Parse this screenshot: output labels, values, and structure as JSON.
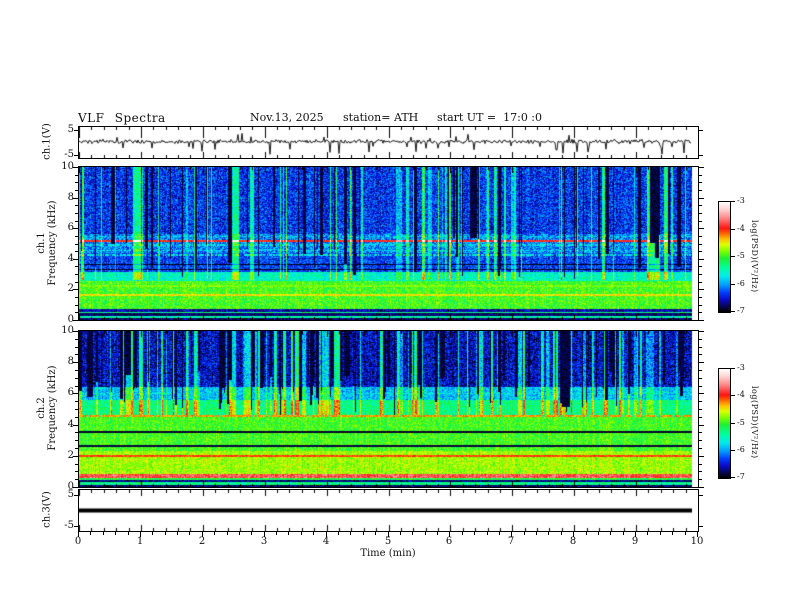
{
  "header": {
    "title": "VLF Spectra",
    "date": "Nov.13, 2025",
    "station": "station= ATH",
    "start_ut": "start UT =  17:0 :0"
  },
  "time_axis": {
    "label": "Time  (min)",
    "major_ticks": [
      0,
      1,
      2,
      3,
      4,
      5,
      6,
      7,
      8,
      9,
      10
    ],
    "minor_step_min": 0.2,
    "range_min": [
      0,
      10
    ]
  },
  "colorbar": {
    "label": "log(PSD)(V²/Hz)",
    "ticks": [
      -3,
      -4,
      -5,
      -6,
      -7
    ],
    "range": [
      -7,
      -3
    ],
    "stops": [
      [
        -7,
        0,
        0,
        0
      ],
      [
        -6.85,
        5,
        5,
        60
      ],
      [
        -6.55,
        10,
        10,
        200
      ],
      [
        -6.3,
        0,
        60,
        255
      ],
      [
        -6.0,
        0,
        160,
        255
      ],
      [
        -5.7,
        0,
        235,
        235
      ],
      [
        -5.4,
        0,
        255,
        160
      ],
      [
        -5.05,
        30,
        240,
        50
      ],
      [
        -4.8,
        120,
        255,
        0
      ],
      [
        -4.55,
        220,
        255,
        0
      ],
      [
        -4.35,
        255,
        190,
        0
      ],
      [
        -4.1,
        255,
        80,
        0
      ],
      [
        -3.95,
        255,
        20,
        20
      ],
      [
        -3.6,
        255,
        130,
        130
      ],
      [
        -3.3,
        255,
        205,
        205
      ],
      [
        -3,
        255,
        255,
        255
      ]
    ]
  },
  "chart_data": [
    {
      "type": "line",
      "id": "wave1",
      "ylabel": "ch.1(V)",
      "yticks": [
        5,
        -5
      ],
      "ylim": [
        -6.5,
        6.5
      ],
      "xlim_min": [
        0,
        10
      ],
      "signal": {
        "baseline_V": 0.4,
        "noise_sigma_V": 0.5,
        "spike_down": {
          "probability_per_sample": 0.05,
          "amplitude_V": [
            1.5,
            5.0
          ]
        },
        "spike_up": {
          "probability_per_sample": 0.015,
          "amplitude_V": [
            1.0,
            2.8
          ]
        }
      },
      "description": "broadband noisy trace near 0 V with frequent negative transient spikes"
    },
    {
      "type": "heatmap",
      "id": "spec1",
      "channel": "ch.1",
      "ylabel": "Frequency  (kHz)",
      "yticks": [
        0,
        2,
        4,
        6,
        8,
        10
      ],
      "ylim_kHz": [
        0,
        10
      ],
      "zlabel": "log(PSD)(V²/Hz)",
      "zlim": [
        -7,
        -3
      ],
      "bands": [
        {
          "f0": 0.0,
          "f1": 0.1,
          "v": -6.8,
          "n": 0.25
        },
        {
          "f0": 0.1,
          "f1": 0.22,
          "v": -5.45,
          "n": 0.3
        },
        {
          "f0": 0.22,
          "f1": 0.4,
          "v": -6.75,
          "n": 0.2
        },
        {
          "f0": 0.4,
          "f1": 0.52,
          "v": -5.3,
          "n": 0.3
        },
        {
          "f0": 0.52,
          "f1": 0.66,
          "v": -6.6,
          "n": 0.3
        },
        {
          "f0": 0.66,
          "f1": 2.55,
          "v": -4.95,
          "n": 0.28
        },
        {
          "f0": 2.55,
          "f1": 3.15,
          "v": -5.55,
          "n": 0.3
        },
        {
          "f0": 3.15,
          "f1": 4.4,
          "v": -6.3,
          "n": 0.35
        },
        {
          "f0": 4.4,
          "f1": 5.6,
          "v": -6.05,
          "n": 0.45
        },
        {
          "f0": 5.6,
          "f1": 10.0,
          "v": -6.35,
          "n": 0.4
        }
      ],
      "spectral_lines": [
        {
          "f": 1.62,
          "v": -4.45,
          "hw": 0.07,
          "seg": 1
        },
        {
          "f": 2.2,
          "v": -4.8,
          "hw": 0.05,
          "seg": 0.8
        },
        {
          "f": 3.3,
          "v": -6.95,
          "hw": 0.05,
          "seg": 1,
          "dark": true
        },
        {
          "f": 3.62,
          "v": -6.95,
          "hw": 0.05,
          "seg": 1,
          "dark": true
        },
        {
          "f": 4.25,
          "v": -5.65,
          "hw": 0.05,
          "seg": 0.7
        },
        {
          "f": 4.55,
          "v": -5.7,
          "hw": 0.05,
          "seg": 0.65
        },
        {
          "f": 4.9,
          "v": -5.7,
          "hw": 0.05,
          "seg": 0.6
        },
        {
          "f": 5.15,
          "v": -3.95,
          "hw": 0.05,
          "seg": 1
        },
        {
          "f": 5.45,
          "v": -5.75,
          "hw": 0.05,
          "seg": 0.55
        }
      ],
      "striping": {
        "bright_prob": 0.26,
        "dark_prob": 0.17,
        "fmin_kHz": 2.6
      }
    },
    {
      "type": "heatmap",
      "id": "spec2",
      "channel": "ch.2",
      "ylabel": "Frequency  (kHz)",
      "yticks": [
        0,
        2,
        4,
        6,
        8,
        10
      ],
      "ylim_kHz": [
        0,
        10
      ],
      "zlabel": "log(PSD)(V²/Hz)",
      "zlim": [
        -7,
        -3
      ],
      "bands": [
        {
          "f0": 0.0,
          "f1": 0.1,
          "v": -6.8,
          "n": 0.3
        },
        {
          "f0": 0.1,
          "f1": 0.26,
          "v": -5.35,
          "n": 0.3
        },
        {
          "f0": 0.26,
          "f1": 0.44,
          "v": -6.7,
          "n": 0.25
        },
        {
          "f0": 0.44,
          "f1": 0.58,
          "v": -5.1,
          "n": 0.3
        },
        {
          "f0": 0.58,
          "f1": 0.78,
          "v": -3.75,
          "n": 0.25
        },
        {
          "f0": 0.78,
          "f1": 2.3,
          "v": -4.7,
          "n": 0.25
        },
        {
          "f0": 2.3,
          "f1": 4.5,
          "v": -4.95,
          "n": 0.25
        },
        {
          "f0": 4.5,
          "f1": 5.6,
          "v": -5.3,
          "n": 0.3
        },
        {
          "f0": 5.6,
          "f1": 6.4,
          "v": -5.85,
          "n": 0.35
        },
        {
          "f0": 6.4,
          "f1": 10.0,
          "v": -6.55,
          "n": 0.4
        }
      ],
      "spectral_lines": [
        {
          "f": 1.95,
          "v": -4.05,
          "hw": 0.07,
          "seg": 1
        },
        {
          "f": 2.6,
          "v": -6.85,
          "hw": 0.05,
          "seg": 1,
          "dark": true
        },
        {
          "f": 3.5,
          "v": -6.9,
          "hw": 0.05,
          "seg": 1,
          "dark": true
        },
        {
          "f": 4.55,
          "v": -4.25,
          "hw": 0.06,
          "seg": 0.85
        },
        {
          "f": 5.0,
          "v": -5.45,
          "hw": 0.05,
          "seg": 0.6
        },
        {
          "f": 5.35,
          "v": -5.5,
          "hw": 0.05,
          "seg": 0.55
        },
        {
          "f": 6.0,
          "v": -5.6,
          "hw": 0.05,
          "seg": 0.6
        }
      ],
      "striping": {
        "bright_prob": 0.3,
        "dark_prob": 0.24,
        "fmin_kHz": 4.6
      }
    },
    {
      "type": "line",
      "id": "wave3",
      "ylabel": "ch.3(V)",
      "yticks": [
        5,
        -5
      ],
      "ylim": [
        -7,
        7
      ],
      "signal": {
        "constant_V": 0,
        "line_thickness_px": 4
      },
      "description": "flat line at 0 V across the full record"
    }
  ]
}
